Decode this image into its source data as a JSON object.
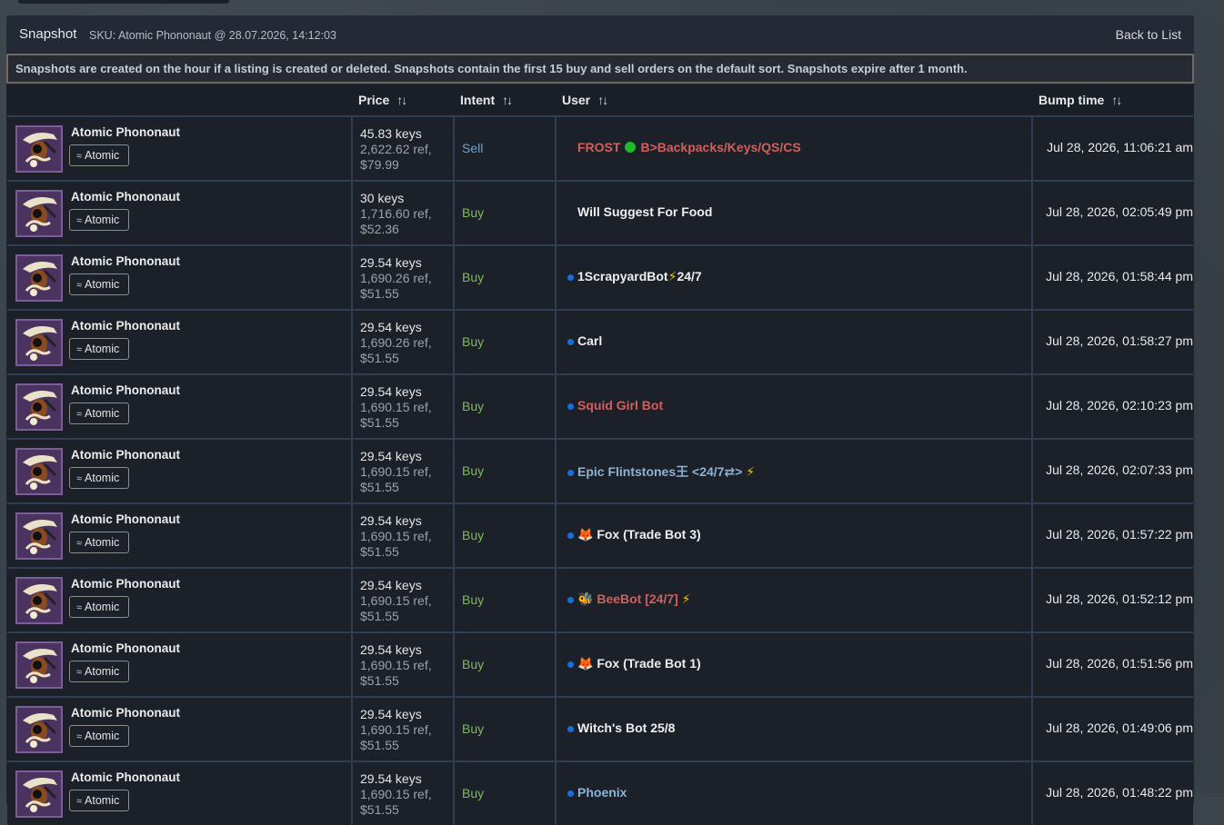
{
  "panel": {
    "title": "Snapshot",
    "sku": "SKU: Atomic Phononaut @ 28.07.2026, 14:12:03",
    "back_label": "Back to List"
  },
  "notice": "Snapshots are created on the hour if a listing is created or deleted. Snapshots contain the first 15 buy and sell orders on the default sort. Snapshots expire after 1 month.",
  "columns": {
    "price": "Price",
    "intent": "Intent",
    "user": "User",
    "bump": "Bump time",
    "sort_icon": "sort-arrows-icon"
  },
  "colors": {
    "panel_bg": "#1e232c",
    "row_border": "#2f3e52",
    "sell": "#6aa5d6",
    "buy": "#7dbb5a",
    "user_red": "#d0605e",
    "online_dot": "#1a6fd6",
    "item_bg": "#4b3360"
  },
  "rows": [
    {
      "item": "Atomic Phononaut",
      "effect": "Atomic",
      "keys": "45.83 keys",
      "ref": "2,622.62 ref,",
      "usd": "$79.99",
      "intent": "Sell",
      "user_a": "FROST",
      "user_b": "B>Backpacks/Keys/QS/CS",
      "bump": "Jul 28, 2026, 11:06:21 am"
    },
    {
      "item": "Atomic Phononaut",
      "effect": "Atomic",
      "keys": "30 keys",
      "ref": "1,716.60 ref,",
      "usd": "$52.36",
      "intent": "Buy",
      "user": "Will Suggest For Food",
      "bump": "Jul 28, 2026, 02:05:49 pm"
    },
    {
      "item": "Atomic Phononaut",
      "effect": "Atomic",
      "keys": "29.54 keys",
      "ref": "1,690.26 ref,",
      "usd": "$51.55",
      "intent": "Buy",
      "user_a": "1ScrapyardBot",
      "user_b": "24/7",
      "bump": "Jul 28, 2026, 01:58:44 pm"
    },
    {
      "item": "Atomic Phononaut",
      "effect": "Atomic",
      "keys": "29.54 keys",
      "ref": "1,690.26 ref,",
      "usd": "$51.55",
      "intent": "Buy",
      "user": "Carl",
      "bump": "Jul 28, 2026, 01:58:27 pm"
    },
    {
      "item": "Atomic Phononaut",
      "effect": "Atomic",
      "keys": "29.54 keys",
      "ref": "1,690.15 ref,",
      "usd": "$51.55",
      "intent": "Buy",
      "user": "Squid Girl Bot",
      "bump": "Jul 28, 2026, 02:10:23 pm"
    },
    {
      "item": "Atomic Phononaut",
      "effect": "Atomic",
      "keys": "29.54 keys",
      "ref": "1,690.15 ref,",
      "usd": "$51.55",
      "intent": "Buy",
      "user": "Epic Flintstones王 <24/7⇄>",
      "bump": "Jul 28, 2026, 02:07:33 pm"
    },
    {
      "item": "Atomic Phononaut",
      "effect": "Atomic",
      "keys": "29.54 keys",
      "ref": "1,690.15 ref,",
      "usd": "$51.55",
      "intent": "Buy",
      "user": "Fox (Trade Bot 3)",
      "bump": "Jul 28, 2026, 01:57:22 pm"
    },
    {
      "item": "Atomic Phononaut",
      "effect": "Atomic",
      "keys": "29.54 keys",
      "ref": "1,690.15 ref,",
      "usd": "$51.55",
      "intent": "Buy",
      "user": "BeeBot [24/7]",
      "bump": "Jul 28, 2026, 01:52:12 pm"
    },
    {
      "item": "Atomic Phononaut",
      "effect": "Atomic",
      "keys": "29.54 keys",
      "ref": "1,690.15 ref,",
      "usd": "$51.55",
      "intent": "Buy",
      "user": "Fox (Trade Bot 1)",
      "bump": "Jul 28, 2026, 01:51:56 pm"
    },
    {
      "item": "Atomic Phononaut",
      "effect": "Atomic",
      "keys": "29.54 keys",
      "ref": "1,690.15 ref,",
      "usd": "$51.55",
      "intent": "Buy",
      "user": "Witch's Bot 25/8",
      "bump": "Jul 28, 2026, 01:49:06 pm"
    },
    {
      "item": "Atomic Phononaut",
      "effect": "Atomic",
      "keys": "29.54 keys",
      "ref": "1,690.15 ref,",
      "usd": "$51.55",
      "intent": "Buy",
      "user": "Phoenix",
      "bump": "Jul 28, 2026, 01:48:22 pm"
    }
  ]
}
